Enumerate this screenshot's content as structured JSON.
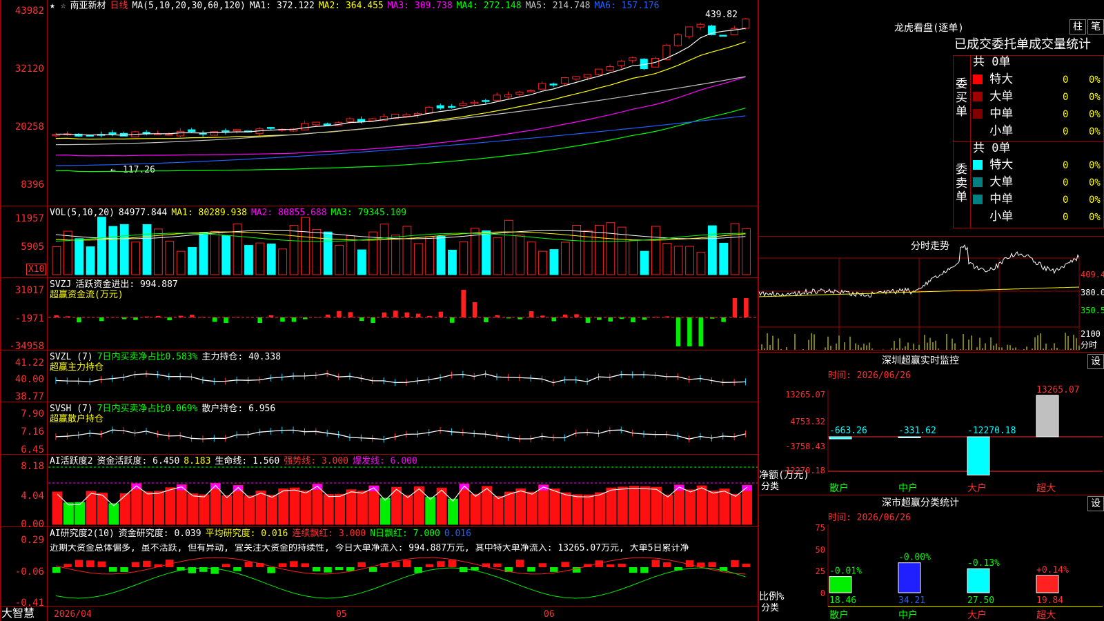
{
  "stock": {
    "name": "南亚新材",
    "period": "日线",
    "ma_params": "MA(5,10,20,30,60,120)",
    "ma1": "MA1: 372.122",
    "ma2": "MA2: 364.455",
    "ma3": "MA3: 309.738",
    "ma4": "MA4: 272.148",
    "ma5": "MA5: 214.748",
    "ma6": "MA6: 157.176",
    "high_label": "439.82",
    "low_label": "117.26"
  },
  "colors": {
    "up": "#ff2020",
    "down": "#00ffff",
    "ma1": "#ffffff",
    "ma2": "#ffff00",
    "ma3": "#ff00ff",
    "ma4": "#00ff00",
    "ma5": "#c0c0c0",
    "ma6": "#2060ff",
    "grid": "#a00000"
  },
  "price_axis": [
    "43982",
    "32120",
    "20258",
    "8396"
  ],
  "vol": {
    "title": "VOL(5,10,20)",
    "value": "84977.844",
    "ma1": "MA1: 80289.938",
    "ma2": "MA2: 80855.688",
    "ma3": "MA3: 79345.109",
    "axis": [
      "11957",
      "5905"
    ],
    "unit": "X10"
  },
  "svzj": {
    "title": "SVZJ",
    "line": "活跃资金进出: 994.887",
    "sub": "超赢资金流(万元)",
    "axis": [
      "31017",
      "-1971",
      "-34958"
    ]
  },
  "svzl": {
    "title": "SVZL (7)",
    "line1": "7日内买卖净占比0.583%",
    "line2": "主力持仓: 40.338",
    "sub": "超赢主力持仓",
    "axis": [
      "41.22",
      "40.00",
      "38.77"
    ]
  },
  "svsh": {
    "title": "SVSH (7)",
    "line1": "7日内买卖净占比0.069%",
    "line2": "散户持仓: 6.956",
    "sub": "超赢散户持仓",
    "axis": [
      "7.90",
      "7.16",
      "6.45"
    ]
  },
  "ai1": {
    "title": "AI活跃度2",
    "a": "资金活跃度: 6.450",
    "b": "8.183",
    "c": "生命线: 1.560",
    "d": "强势线: 3.000",
    "e": "爆发线: 6.000",
    "axis": [
      "8.18",
      "4.04",
      "0.00"
    ]
  },
  "ai2": {
    "title": "AI研究度2(10)",
    "a": "资金研究度: 0.039",
    "b": "平均研究度: 0.016",
    "c": "连续飘红: 3.000",
    "d": "N日飘红: 7.000",
    "e": "0.016",
    "axis": [
      "0.29",
      "-0.06",
      "-0.41"
    ],
    "text": "近期大资金总体偏多, 虽不活跃, 但有异动, 宜关注大资金的持续性, 今日大单净流入: 994.887万元, 其中特大单净流入: 13265.07万元, 大单5日累计净"
  },
  "xaxis": {
    "brand": "大智慧",
    "d1": "2026/04",
    "d2": "05",
    "d3": "06"
  },
  "dragon": {
    "title": "龙虎看盘(逐单)",
    "btn1": "柱",
    "btn2": "笔",
    "header": "已成交委托单成交量统计",
    "buy_label": "委买单",
    "sell_label": "委卖单",
    "buy_total": "共 0单",
    "sell_total": "共 0单",
    "buy": [
      {
        "label": "特大",
        "count": "0",
        "pct": "0%"
      },
      {
        "label": "大单",
        "count": "0",
        "pct": "0%"
      },
      {
        "label": "中单",
        "count": "0",
        "pct": "0%"
      },
      {
        "label": "小单",
        "count": "0",
        "pct": "0%"
      }
    ],
    "sell": [
      {
        "label": "特大",
        "count": "0",
        "pct": "0%"
      },
      {
        "label": "大单",
        "count": "0",
        "pct": "0%"
      },
      {
        "label": "中单",
        "count": "0",
        "pct": "0%"
      },
      {
        "label": "小单",
        "count": "0",
        "pct": "0%"
      }
    ]
  },
  "intraday": {
    "title": "分时走势",
    "p1": "409.4",
    "p2": "380.0",
    "p3": "350.5",
    "vol": "2100",
    "unit": "分时"
  },
  "monitor": {
    "title": "深圳超赢实时监控",
    "set": "设",
    "date": "时间: 2026/06/26",
    "axis": [
      "13265.07",
      "4753.32",
      "-3758.43",
      "-12270.18"
    ],
    "ylabel": "净额(万元)",
    "xlabel": "分类",
    "cats": [
      "散户",
      "中户",
      "大户",
      "超大"
    ],
    "values": [
      "-663.26",
      "-331.62",
      "-12270.18",
      "13265.07"
    ]
  },
  "classify": {
    "title": "深市超赢分类统计",
    "set": "设",
    "date": "时间: 2026/06/26",
    "axis": [
      "75",
      "50",
      "25",
      "0"
    ],
    "ylabel": "比例%",
    "xlabel": "分类",
    "cats": [
      "散户",
      "中户",
      "大户",
      "超大"
    ],
    "values": [
      "18.46",
      "34.21",
      "27.50",
      "19.84"
    ],
    "changes": [
      "-0.01%",
      "-0.00%",
      "-0.13%",
      "+0.14%"
    ]
  }
}
